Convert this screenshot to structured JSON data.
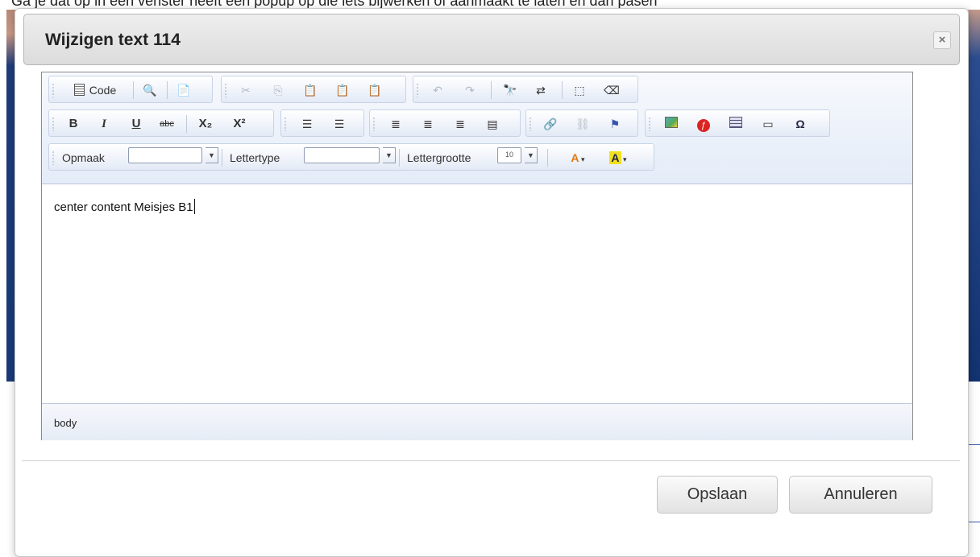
{
  "background": {
    "partial_text": "Ga je dat op in een venster heeft een popup op die iets bijwerken of aanmaakt te laten en dan pasen"
  },
  "modal": {
    "title": "Wijzigen text 114",
    "close_label": "×",
    "save_label": "Opslaan",
    "cancel_label": "Annuleren"
  },
  "toolbar": {
    "code_label": "Code",
    "bold": "B",
    "italic": "I",
    "underline": "U",
    "strike": "abc",
    "subscript": "X₂",
    "superscript": "X²",
    "format_label": "Opmaak",
    "font_label": "Lettertype",
    "size_label": "Lettergrootte",
    "size_value": "10",
    "text_color": "A",
    "bg_color": "A",
    "special_char": "Ω"
  },
  "editor": {
    "content": "center content Meisjes B1",
    "status_path": "body"
  },
  "colors": {
    "header_bg": "#e4e4e4",
    "toolbar_bg": "#e8eef8",
    "page_band": "#1a3a78",
    "accent_yellow": "#f0e020"
  }
}
